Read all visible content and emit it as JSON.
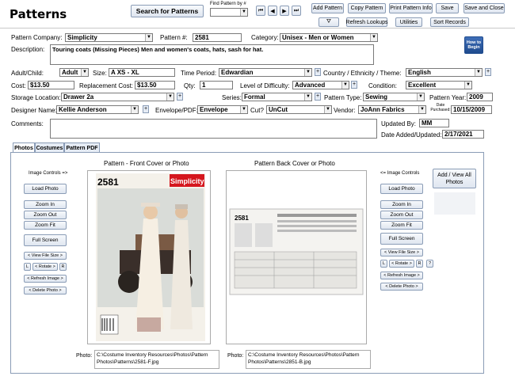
{
  "header": {
    "title": "Patterns",
    "search_button": "Search for Patterns",
    "find_label": "Find Pattern by #",
    "buttons": {
      "add": "Add Pattern",
      "copy": "Copy Pattern",
      "print": "Print Pattern Info",
      "save": "Save",
      "save_close": "Save and Close",
      "refresh": "Refresh Lookups",
      "utilities": "Utilities",
      "sort": "Sort Records"
    }
  },
  "form": {
    "company_label": "Pattern Company:",
    "company": "Simplicity",
    "number_label": "Pattern #:",
    "number": "2581",
    "category_label": "Category:",
    "category": "Unisex - Men or Women",
    "description_label": "Description:",
    "description": "Touring coats (Missing Pieces) Men and women's coats, hats, sash for hat.",
    "howto": "How to Begin",
    "adult_label": "Adult/Child:",
    "adult": "Adult",
    "size_label": "Size:",
    "size": "A  XS - XL",
    "period_label": "Time Period:",
    "period": "Edwardian",
    "country_label": "Country / Ethnicity / Theme:",
    "country": "English",
    "cost_label": "Cost:",
    "cost": "$13.50",
    "replacement_label": "Replacement Cost:",
    "replacement": "$13.50",
    "qty_label": "Qty:",
    "qty": "1",
    "difficulty_label": "Level of Difficulty:",
    "difficulty": "Advanced",
    "condition_label": "Condition:",
    "condition": "Excellent",
    "storage_label": "Storage Location:",
    "storage": "Drawer 2a",
    "series_label": "Series:",
    "series": "Formal",
    "type_label": "Pattern Type:",
    "type": "Sewing",
    "year_label": "Pattern Year:",
    "year": "2009",
    "designer_label": "Designer Name:",
    "designer": "Kellie Anderson",
    "envelope_label": "Envelope/PDF:",
    "envelope": "Envelope",
    "cut_label": "Cut?",
    "cut": "UnCut",
    "vendor_label": "Vendor:",
    "vendor": "JoAnn Fabrics",
    "date_label": "Date Purchased:",
    "date": "10/15/2009",
    "comments_label": "Comments:",
    "updated_by_label": "Updated By:",
    "updated_by": "MM",
    "date_added_label": "Date Added/Updated:",
    "date_added": "2/17/2021"
  },
  "tabs": [
    "Photos",
    "Costumes",
    "Pattern PDF"
  ],
  "photos": {
    "left_controls_label": "Image Controls =>",
    "right_controls_label": "<= Image Controls",
    "front_title": "Pattern - Front Cover or Photo",
    "back_title": "Pattern Back Cover or Photo",
    "load": "Load Photo",
    "zoom_in": "Zoom In",
    "zoom_out": "Zoom Out",
    "zoom_fit": "Zoom Fit",
    "full": "Full Screen",
    "view_size": "< View File Size >",
    "l": "L",
    "rotate": "< Rotate >",
    "r": "R",
    "refresh": "< Refresh Image >",
    "delete": "< Delete Photo >",
    "add_view": "Add / View All Photos",
    "help": "?",
    "photo_label": "Photo:",
    "front_path": "C:\\Costume Inventory Resources\\Photos\\Pattern Photos\\Patterns\\2581-F.jpg",
    "back_path": "C:\\Costume Inventory Resources\\Photos\\Pattern Photos\\Patterns\\2851-B.jpg",
    "cover_number": "2581",
    "cover_brand": "Simplicity",
    "back_number": "2581"
  }
}
